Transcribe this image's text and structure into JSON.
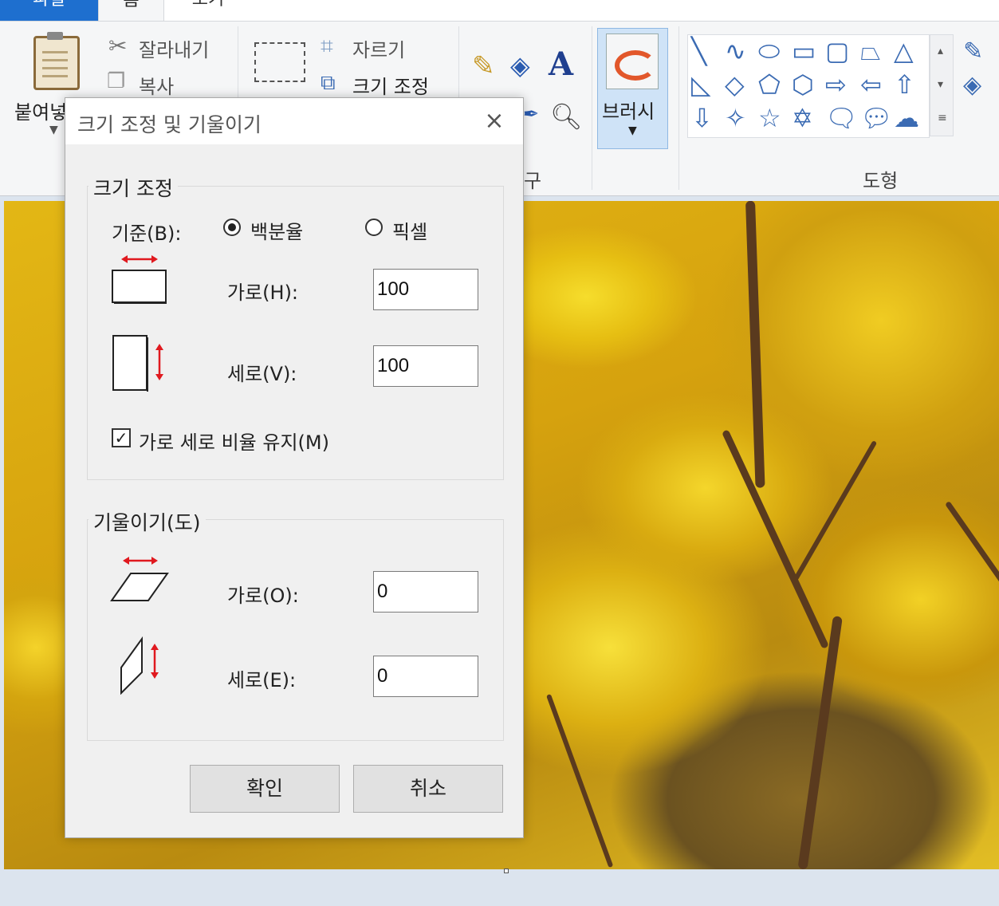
{
  "tabs": {
    "file": "파일",
    "home": "홈",
    "view": "보기"
  },
  "ribbon": {
    "paste": "붙여넣",
    "cut": "잘라내기",
    "copy": "복사",
    "crop": "자르기",
    "resize": "크기 조정",
    "tools_group_partial": "구",
    "brush": "브러시",
    "shapes_group": "도형"
  },
  "dialog": {
    "title": "크기 조정 및 기울이기",
    "resize_group": "크기 조정",
    "basis_label": "기준(B):",
    "percent_label": "백분율",
    "pixel_label": "픽셀",
    "percent_selected": true,
    "horizontal_label": "가로(H):",
    "horizontal_value": "100",
    "vertical_label": "세로(V):",
    "vertical_value": "100",
    "keep_ratio_label": "가로 세로 비율 유지(M)",
    "keep_ratio_checked": true,
    "skew_group": "기울이기(도)",
    "skew_h_label": "가로(O):",
    "skew_h_value": "0",
    "skew_v_label": "세로(E):",
    "skew_v_value": "0",
    "ok": "확인",
    "cancel": "취소"
  },
  "colors": {
    "accent": "#1e6fcf",
    "arrow_red": "#e0191f",
    "brush_highlight": "#cfe3f7"
  },
  "icons": [
    "cut-icon",
    "copy-icon",
    "crop-icon",
    "resize-icon",
    "pencil-icon",
    "fill-icon",
    "text-icon",
    "color-picker-icon",
    "magnifier-icon",
    "brush-icon",
    "clipboard-icon",
    "close-icon"
  ]
}
